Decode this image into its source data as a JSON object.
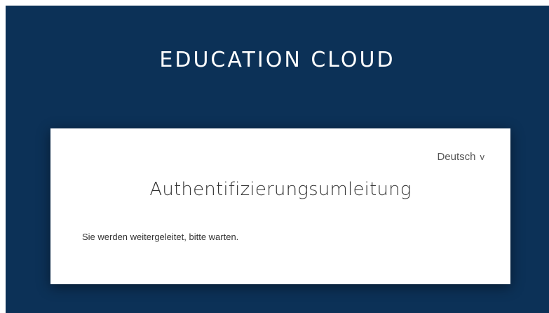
{
  "header": {
    "brand": "EDUCATION CLOUD"
  },
  "card": {
    "language": {
      "selected": "Deutsch",
      "chevron": "v",
      "icon": "chevron-down-icon"
    },
    "title": "Authentifizierungsumleitung",
    "message": "Sie werden weitergeleitet, bitte warten."
  },
  "colors": {
    "background": "#0c3157",
    "card": "#ffffff",
    "text": "#333333"
  }
}
